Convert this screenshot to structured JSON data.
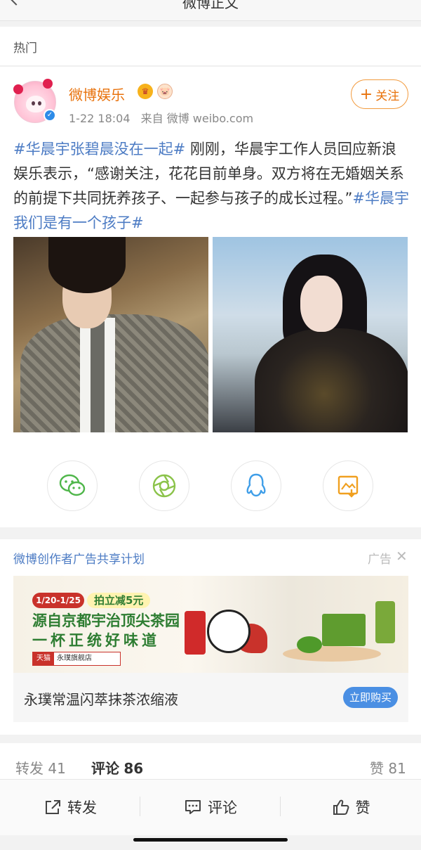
{
  "header": {
    "title": "微博正文"
  },
  "section": {
    "label": "热门"
  },
  "post": {
    "username": "微博娱乐",
    "time": "1-22 18:04",
    "source": "来自 微博 weibo.com",
    "follow_label": "关注",
    "content": {
      "tag1": "#华晨宇张碧晨没在一起#",
      "body": " 刚刚，华晨宇工作人员回应新浪娱乐表示，“感谢关注，花花目前单身。双方将在无婚姻关系的前提下共同抚养孩子、一起参与孩子的成长过程。”",
      "tag2": "#华晨宇 我们是有一个孩子#"
    },
    "share_icons": [
      "wechat-icon",
      "moments-icon",
      "qq-icon",
      "save-image-icon"
    ]
  },
  "ad": {
    "title": "微博创作者广告共享计划",
    "label": "广告",
    "banner": {
      "date": "1/20-1/25",
      "discount": "拍立减5元",
      "line1": "源自京都宇治顶尖茶园",
      "line2": "一杯正统好味道",
      "tmall": "天猫",
      "shop": "永璞旗舰店"
    },
    "product": "永璞常温闪萃抹茶浓缩液",
    "buy_label": "立即购买"
  },
  "counts": {
    "repost_label": "转发",
    "repost": "41",
    "comment_label": "评论",
    "comment": "86",
    "like_label": "赞",
    "like": "81"
  },
  "actions": {
    "repost": "转发",
    "comment": "评论",
    "like": "赞"
  },
  "colors": {
    "accent": "#e8720c",
    "link": "#4d7cc4",
    "button": "#4a8fe3"
  }
}
